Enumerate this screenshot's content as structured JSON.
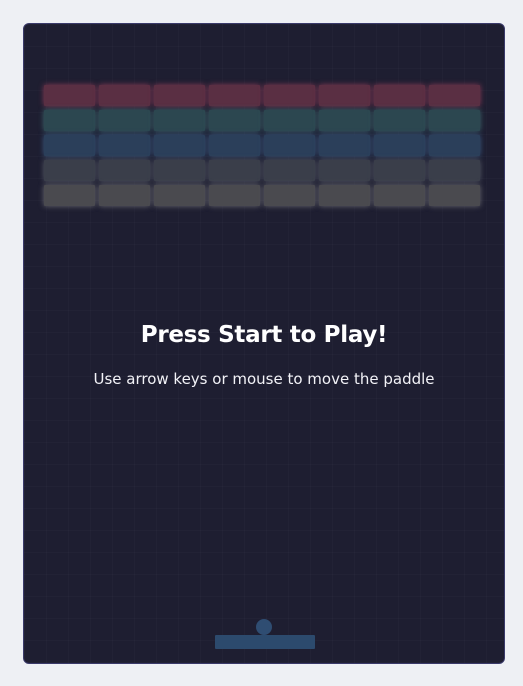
{
  "game": {
    "title": "Press Start to Play!",
    "instructions": "Use arrow keys or mouse to move the paddle"
  },
  "colors": {
    "background": "#1e1e31",
    "frame_border": "#3a3a6a",
    "text": "#ffffff",
    "ball": "#2f4d72",
    "paddle": "#2c4a6d"
  },
  "bricks": {
    "columns": 8,
    "rows": [
      {
        "color": "#5a2f43",
        "glow": "#8a3a55"
      },
      {
        "color": "#2c4750",
        "glow": "#3e6a6f"
      },
      {
        "color": "#2b3f5a",
        "glow": "#3a5a82"
      },
      {
        "color": "#3a3e4a",
        "glow": "#555a66"
      },
      {
        "color": "#4a4a4f",
        "glow": "#6a6a70"
      }
    ]
  }
}
